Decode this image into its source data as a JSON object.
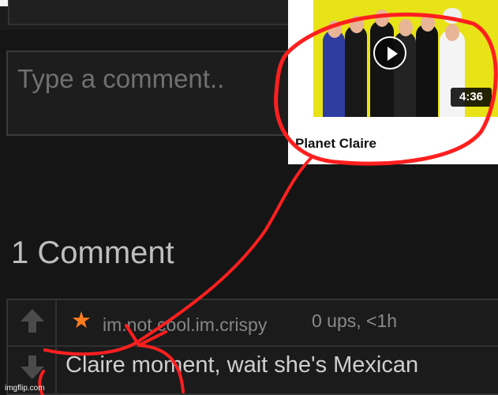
{
  "comment_input": {
    "placeholder": "Type a comment.."
  },
  "video_card": {
    "title": "Planet Claire",
    "duration": "4:36"
  },
  "comments_section": {
    "count_label": "1 Comment"
  },
  "comment": {
    "username": "im.not.cool.im.crispy",
    "meta": "0 ups, <1h",
    "text": "Claire moment, wait she's Mexican"
  },
  "watermark": {
    "text": "imgflip.com"
  },
  "icons": {
    "upvote": "up-arrow-icon",
    "downvote": "down-arrow-icon",
    "featured": "star-icon",
    "play": "play-icon"
  },
  "colors": {
    "annotation": "#ff1f1f",
    "star": "#ff7c1c",
    "thumbnail_background": "#e8e316"
  }
}
